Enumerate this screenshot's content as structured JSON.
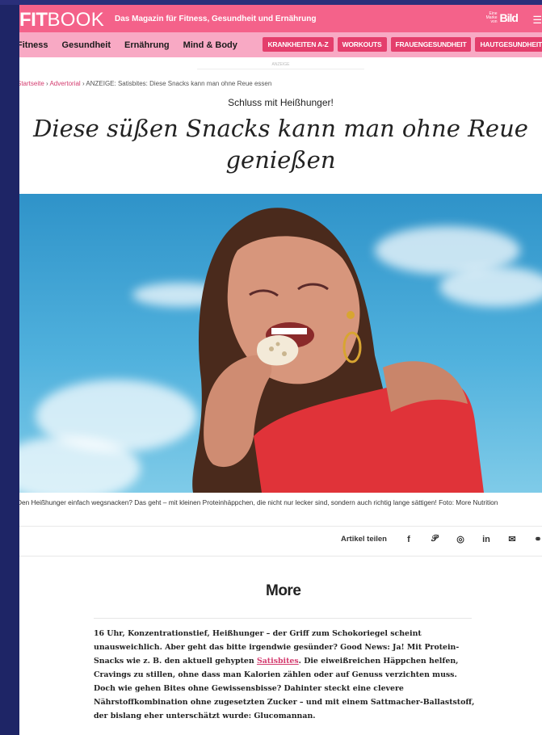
{
  "header": {
    "logo_fit": "FIT",
    "logo_book": "BOOK",
    "tagline": "Das Magazin für Fitness, Gesundheit und Ernährung",
    "bild_small": "Eine Marke von",
    "bild_logo": "Bild",
    "menu_icon": "hamburger-menu-icon"
  },
  "nav": {
    "items": [
      "Fitness",
      "Gesundheit",
      "Ernährung",
      "Mind & Body"
    ],
    "buttons": [
      "KRANKHEITEN A-Z",
      "WORKOUTS",
      "FRAUENGESUNDHEIT",
      "HAUTGESUNDHEIT"
    ]
  },
  "ad": {
    "label": "ANZEIGE"
  },
  "breadcrumb": {
    "home": "Startseite",
    "sep1": " › ",
    "category": "Advertorial",
    "sep2": " › ",
    "current": "ANZEIGE: Satisbites: Diese Snacks kann man ohne Reue essen"
  },
  "article": {
    "kicker": "Schluss mit Heißhunger!",
    "headline": "Diese süßen Snacks kann man ohne Reue genießen",
    "caption": "Den Heißhunger einfach wegsnacken? Das geht – mit kleinen Proteinhäppchen, die nicht nur lecker sind, sondern auch richtig lange sättigen! Foto: More Nutrition"
  },
  "share": {
    "label": "Artikel teilen",
    "icons": [
      "facebook-icon",
      "pinterest-icon",
      "whatsapp-icon",
      "linkedin-icon",
      "email-icon",
      "link-icon"
    ]
  },
  "sponsor": {
    "logo": "More"
  },
  "body": {
    "p1_a": "16 Uhr, Konzentrationstief, Heißhunger – der Griff zum Schokoriegel scheint unausweichlich. Aber geht das bitte irgendwie gesünder? Good News: Ja! Mit Protein-Snacks wie z. B. den aktuell gehypten ",
    "p1_link": "Satisbites",
    "p1_b": ". Die eiweißreichen Häppchen helfen, Cravings zu stillen, ohne dass man Kalorien zählen oder auf Genuss verzichten muss. Doch wie gehen Bites ohne Gewissensbisse? Dahinter steckt eine clevere Nährstoffkombination ohne zugesetzten Zucker – und mit einem Sattmacher-Ballaststoff, der bislang eher unterschätzt wurde: Glucomannan."
  },
  "colors": {
    "brand_pink": "#f4628a",
    "nav_pink": "#f8a9c4",
    "button_pink": "#e43e6c",
    "link_pink": "#d33b6e",
    "sky_blue": "#3ea3d6"
  }
}
